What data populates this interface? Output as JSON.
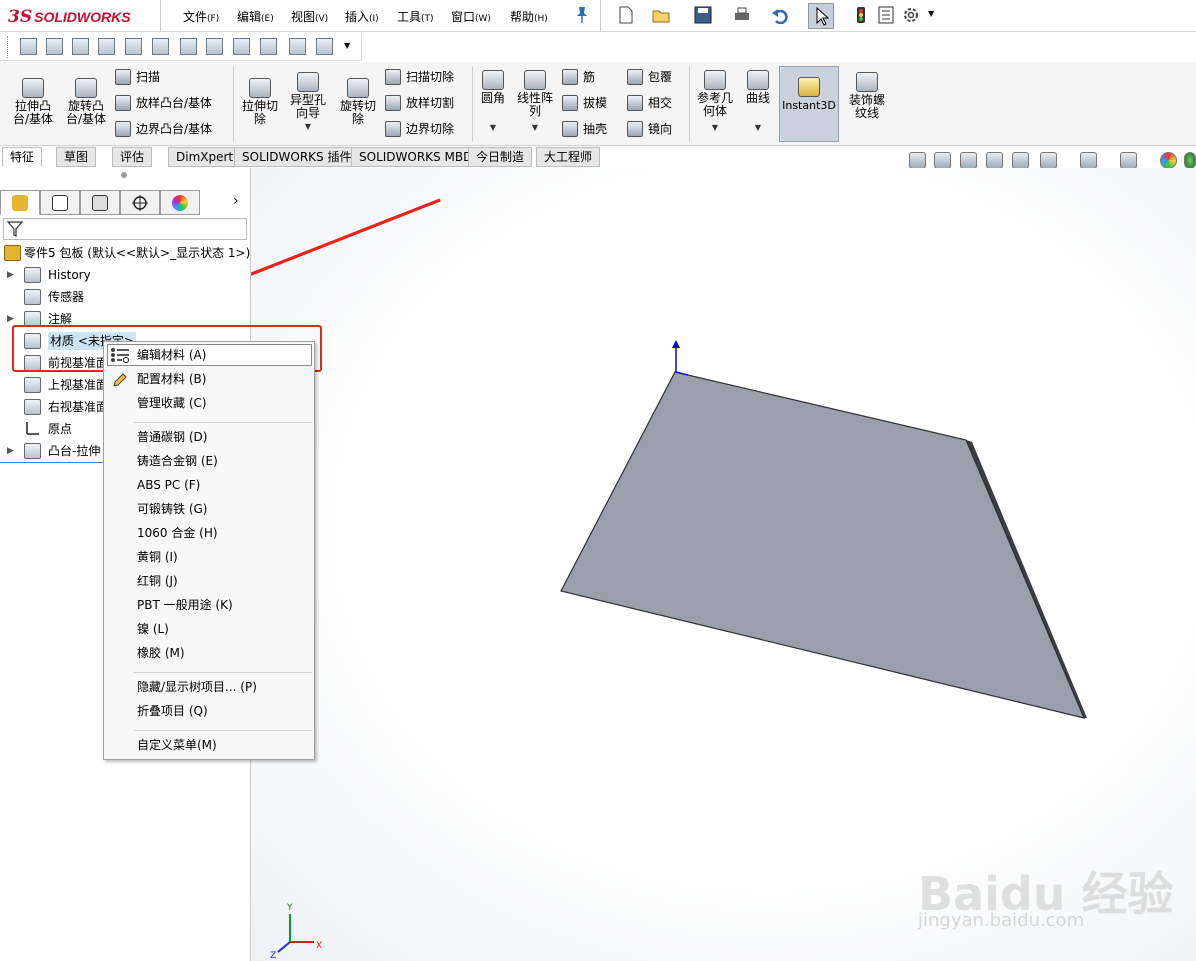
{
  "app": {
    "brand_ds": "3S",
    "brand_name": "SOLIDWORKS"
  },
  "menu": [
    {
      "label": "文件",
      "key": "(F)"
    },
    {
      "label": "编辑",
      "key": "(E)"
    },
    {
      "label": "视图",
      "key": "(V)"
    },
    {
      "label": "插入",
      "key": "(I)"
    },
    {
      "label": "工具",
      "key": "(T)"
    },
    {
      "label": "窗口",
      "key": "(W)"
    },
    {
      "label": "帮助",
      "key": "(H)"
    }
  ],
  "features": {
    "extrude_boss": "拉伸凸\n台/基体",
    "revolve_boss": "旋转凸\n台/基体",
    "sweep": "扫描",
    "loft_boss": "放样凸台/基体",
    "boundary_boss": "边界凸台/基体",
    "extrude_cut": "拉伸切\n除",
    "hole_wizard": "异型孔\n向导",
    "revolve_cut": "旋转切\n除",
    "sweep_cut": "扫描切除",
    "loft_cut": "放样切割",
    "boundary_cut": "边界切除",
    "fillet": "圆角",
    "linear_pattern": "线性阵\n列",
    "rib": "筋",
    "draft": "拔模",
    "shell": "抽壳",
    "wrap": "包覆",
    "intersect": "相交",
    "mirror": "镜向",
    "ref_geometry": "参考几\n何体",
    "curves": "曲线",
    "instant3d": "Instant3D",
    "cosmetic_thread": "装饰螺\n纹线"
  },
  "tabs": [
    "特征",
    "草图",
    "评估",
    "DimXpert",
    "SOLIDWORKS 插件",
    "SOLIDWORKS MBD",
    "今日制造",
    "大工程师"
  ],
  "tree": {
    "root": "零件5 包板  (默认<<默认>_显示状态 1>)",
    "items": [
      "History",
      "传感器",
      "注解",
      "材质 <未指定>",
      "前视基准面",
      "上视基准面",
      "右视基准面",
      "原点",
      "凸台-拉伸"
    ]
  },
  "context_menu": {
    "group1": [
      "编辑材料 (A)",
      "配置材料 (B)",
      "管理收藏 (C)"
    ],
    "group2": [
      "普通碳钢 (D)",
      "铸造合金钢 (E)",
      "ABS PC (F)",
      "可锻铸铁 (G)",
      "1060 合金 (H)",
      "黄铜 (I)",
      "红铜 (J)",
      "PBT 一般用途 (K)",
      "镍 (L)",
      "橡胶 (M)"
    ],
    "group3": [
      "隐藏/显示树项目... (P)",
      "折叠项目 (Q)"
    ],
    "group4": [
      "自定义菜单(M)"
    ]
  },
  "triad": {
    "x": "X",
    "y": "Y",
    "z": "Z"
  },
  "watermark": {
    "main": "Baidu 经验",
    "sub": "jingyan.baidu.com"
  },
  "colors": {
    "highlight_red": "#e8241c",
    "plate_face": "#9b9eab",
    "brand_red": "#c8102e"
  }
}
